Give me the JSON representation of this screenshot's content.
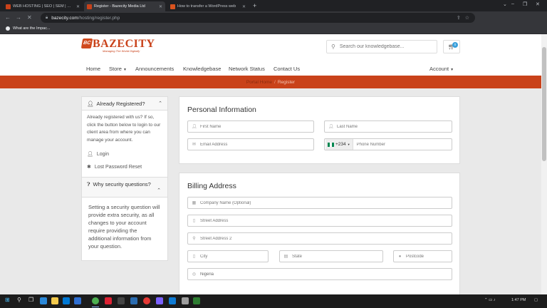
{
  "browser": {
    "tabs": [
      {
        "title": "WEB HOSTING | SEO | SEM | WEB",
        "favicon_color": "#c9421a"
      },
      {
        "title": "Register - Bazecity Media Ltd",
        "favicon_color": "#c9421a"
      },
      {
        "title": "How to transfer a WordPress web",
        "favicon_color": "#d9531e"
      }
    ],
    "url_host": "bazecity.com",
    "url_path": "/hosting/register.php",
    "bookmark": "What are the Impac..."
  },
  "header": {
    "logo_badge": "BC",
    "logo_name": "BAZECITY",
    "logo_tagline": "Managing The World Digitally",
    "search_placeholder": "Search our knowledgebase...",
    "cart_count": "0"
  },
  "nav": {
    "home": "Home",
    "store": "Store",
    "announcements": "Announcements",
    "knowledgebase": "Knowledgebase",
    "network_status": "Network Status",
    "contact_us": "Contact Us",
    "account": "Account"
  },
  "breadcrumb": {
    "parent": "Portal Home",
    "current": "Register"
  },
  "sidebar": {
    "registered": {
      "title": "Already Registered?",
      "text": "Already registered with us? If so, click the button below to login to our client area from where you can manage your account.",
      "login": "Login",
      "reset": "Lost Password Reset"
    },
    "security": {
      "title": "Why security questions?",
      "text": "Setting a security question will provide extra security, as all changes to your account require providing the additional information from your question."
    }
  },
  "personal": {
    "title": "Personal Information",
    "first_name": "First Name",
    "last_name": "Last Name",
    "email": "Email Address",
    "phone_code": "+234",
    "phone": "Phone Number"
  },
  "billing": {
    "title": "Billing Address",
    "company": "Company Name (Optional)",
    "street": "Street Address",
    "street2": "Street Address 2",
    "city": "City",
    "state": "State",
    "postcode": "Postcode",
    "country": "Nigeria"
  },
  "taskbar": {
    "time": "1:47 PM"
  },
  "colors": {
    "brand": "#c9421a",
    "accent_blue": "#3aa0dc"
  }
}
